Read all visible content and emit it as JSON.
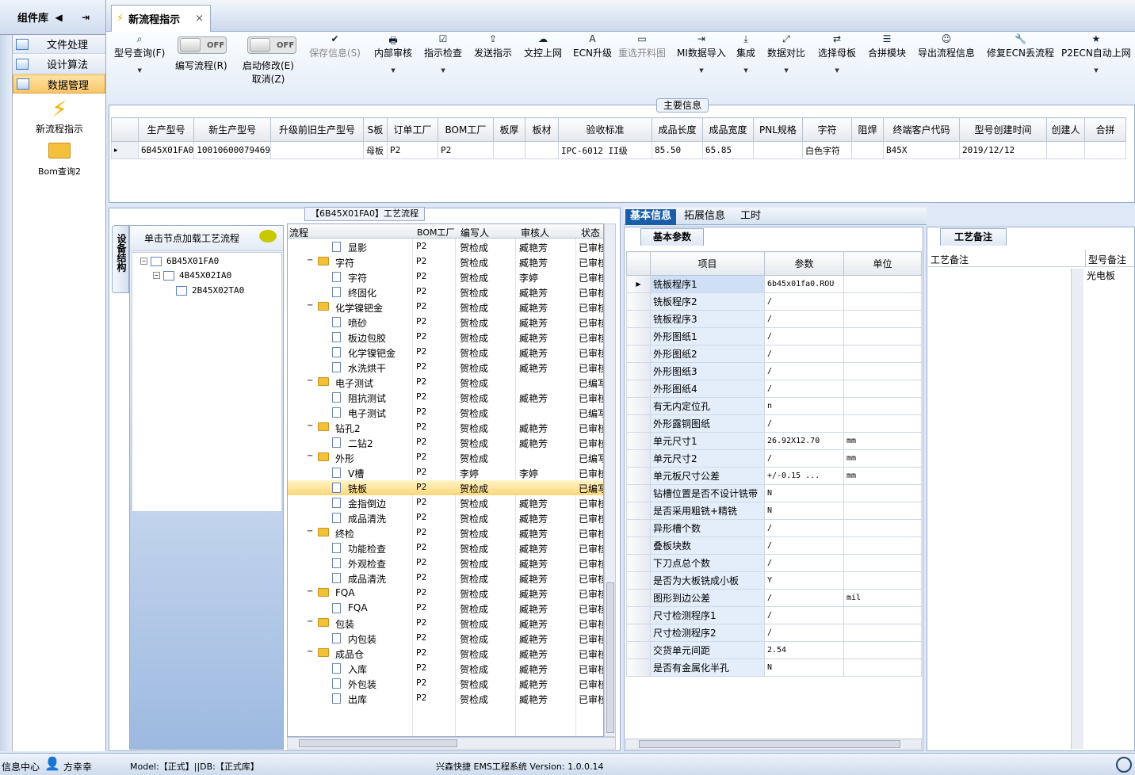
{
  "sidebar": {
    "title": "组件库",
    "items": [
      {
        "label": "文件处理"
      },
      {
        "label": "设计算法"
      },
      {
        "label": "数据管理"
      }
    ],
    "launchers": [
      {
        "label": "新流程指示"
      },
      {
        "label": "Bom查询2"
      }
    ]
  },
  "tab": {
    "title": "新流程指示",
    "close": "×"
  },
  "toolbar": {
    "buttons": [
      {
        "label": "型号查询(F)",
        "icon": "search-icon",
        "glyph": "🔍"
      },
      {
        "label": "编写流程(R)"
      },
      {
        "label": "启动修改(E)",
        "sub": "取消(Z)"
      },
      {
        "label": "保存信息(S)",
        "glyph": "✔"
      },
      {
        "label": "内部审核",
        "glyph": "🖶"
      },
      {
        "label": "指示检查",
        "glyph": "☑"
      },
      {
        "label": "发送指示",
        "glyph": "⇪"
      },
      {
        "label": "文控上网",
        "glyph": "☁"
      },
      {
        "label": "ECN升级",
        "glyph": "A"
      },
      {
        "label": "重选开料图",
        "glyph": "▭"
      },
      {
        "label": "MI数据导入",
        "glyph": "⇥"
      },
      {
        "label": "集成",
        "glyph": "⤓"
      },
      {
        "label": "数据对比",
        "glyph": "⤢"
      },
      {
        "label": "选择母板",
        "glyph": "⇄"
      },
      {
        "label": "合拼模块",
        "glyph": "☰"
      },
      {
        "label": "导出流程信息",
        "glyph": "☺"
      },
      {
        "label": "修复ECN丢流程",
        "glyph": "🔧"
      },
      {
        "label": "P2ECN自动上网",
        "glyph": "★"
      }
    ],
    "toggle_off": "OFF"
  },
  "main": {
    "label": "主要信息",
    "headers": [
      "生产型号",
      "新生产型号",
      "升级前旧生产型号",
      "S板",
      "订单工厂",
      "BOM工厂",
      "板厚",
      "板材",
      "验收标准",
      "成品长度",
      "成品宽度",
      "PNL规格",
      "字符",
      "阻焊",
      "终端客户代码",
      "型号创建时间",
      "创建人",
      "合拼"
    ],
    "row": [
      "6B45X01FA0",
      "10010600079469",
      "",
      "母板",
      "P2",
      "P2",
      "",
      "",
      "IPC-6012 II级",
      "85.50",
      "65.85",
      "",
      "白色字符",
      "",
      "B45X",
      "2019/12/12",
      ""
    ]
  },
  "flow": {
    "label": "【6B45X01FA0】工艺流程",
    "vtab": "设备结构",
    "tree_hint": "单击节点加载工艺流程",
    "tree": [
      "6B45X01FA0",
      "4B45X02IA0",
      "2B45X02TA0"
    ],
    "headers": [
      "流程",
      "BOM工厂",
      "编写人",
      "审核人",
      "状态"
    ],
    "rows": [
      {
        "t": "doc",
        "n": "显影",
        "f": "P2",
        "w": "贺检成",
        "r": "臧艳芳",
        "s": "已审核"
      },
      {
        "t": "fold",
        "n": "字符",
        "f": "P2",
        "w": "贺检成",
        "r": "臧艳芳",
        "s": "已审核"
      },
      {
        "t": "doc",
        "n": "字符",
        "f": "P2",
        "w": "贺检成",
        "r": "李婷",
        "s": "已审核"
      },
      {
        "t": "doc",
        "n": "终固化",
        "f": "P2",
        "w": "贺检成",
        "r": "臧艳芳",
        "s": "已审核"
      },
      {
        "t": "fold",
        "n": "化学镍钯金",
        "f": "P2",
        "w": "贺检成",
        "r": "臧艳芳",
        "s": "已审核"
      },
      {
        "t": "doc",
        "n": "喷砂",
        "f": "P2",
        "w": "贺检成",
        "r": "臧艳芳",
        "s": "已审核"
      },
      {
        "t": "doc",
        "n": "板边包胶",
        "f": "P2",
        "w": "贺检成",
        "r": "臧艳芳",
        "s": "已审核"
      },
      {
        "t": "doc",
        "n": "化学镍钯金",
        "f": "P2",
        "w": "贺检成",
        "r": "臧艳芳",
        "s": "已审核"
      },
      {
        "t": "doc",
        "n": "水洗烘干",
        "f": "P2",
        "w": "贺检成",
        "r": "臧艳芳",
        "s": "已审核"
      },
      {
        "t": "fold",
        "n": "电子测试",
        "f": "P2",
        "w": "贺检成",
        "r": "",
        "s": "已编写"
      },
      {
        "t": "doc",
        "n": "阻抗测试",
        "f": "P2",
        "w": "贺检成",
        "r": "臧艳芳",
        "s": "已审核"
      },
      {
        "t": "doc",
        "n": "电子测试",
        "f": "P2",
        "w": "贺检成",
        "r": "",
        "s": "已编写"
      },
      {
        "t": "fold",
        "n": "钻孔2",
        "f": "P2",
        "w": "贺检成",
        "r": "臧艳芳",
        "s": "已审核"
      },
      {
        "t": "doc",
        "n": "二钻2",
        "f": "P2",
        "w": "贺检成",
        "r": "臧艳芳",
        "s": "已审核"
      },
      {
        "t": "fold",
        "n": "外形",
        "f": "P2",
        "w": "贺检成",
        "r": "",
        "s": "已编写"
      },
      {
        "t": "doc",
        "n": "V槽",
        "f": "P2",
        "w": "李婷",
        "r": "李婷",
        "s": "已审核"
      },
      {
        "t": "doc",
        "n": "铣板",
        "f": "P2",
        "w": "贺检成",
        "r": "",
        "s": "已编写",
        "hl": true
      },
      {
        "t": "doc",
        "n": "金指倒边",
        "f": "P2",
        "w": "贺检成",
        "r": "臧艳芳",
        "s": "已审核"
      },
      {
        "t": "doc",
        "n": "成品清洗",
        "f": "P2",
        "w": "贺检成",
        "r": "臧艳芳",
        "s": "已审核"
      },
      {
        "t": "fold",
        "n": "终检",
        "f": "P2",
        "w": "贺检成",
        "r": "臧艳芳",
        "s": "已审核"
      },
      {
        "t": "doc",
        "n": "功能检查",
        "f": "P2",
        "w": "贺检成",
        "r": "臧艳芳",
        "s": "已审核"
      },
      {
        "t": "doc",
        "n": "外观检查",
        "f": "P2",
        "w": "贺检成",
        "r": "臧艳芳",
        "s": "已审核"
      },
      {
        "t": "doc",
        "n": "成品清洗",
        "f": "P2",
        "w": "贺检成",
        "r": "臧艳芳",
        "s": "已审核"
      },
      {
        "t": "fold",
        "n": "FQA",
        "f": "P2",
        "w": "贺检成",
        "r": "臧艳芳",
        "s": "已审核"
      },
      {
        "t": "doc",
        "n": "FQA",
        "f": "P2",
        "w": "贺检成",
        "r": "臧艳芳",
        "s": "已审核"
      },
      {
        "t": "fold",
        "n": "包装",
        "f": "P2",
        "w": "贺检成",
        "r": "臧艳芳",
        "s": "已审核"
      },
      {
        "t": "doc",
        "n": "内包装",
        "f": "P2",
        "w": "贺检成",
        "r": "臧艳芳",
        "s": "已审核"
      },
      {
        "t": "fold",
        "n": "成品仓",
        "f": "P2",
        "w": "贺检成",
        "r": "臧艳芳",
        "s": "已审核"
      },
      {
        "t": "doc",
        "n": "入库",
        "f": "P2",
        "w": "贺检成",
        "r": "臧艳芳",
        "s": "已审核"
      },
      {
        "t": "doc",
        "n": "外包装",
        "f": "P2",
        "w": "贺检成",
        "r": "臧艳芳",
        "s": "已审核"
      },
      {
        "t": "doc",
        "n": "出库",
        "f": "P2",
        "w": "贺检成",
        "r": "臧艳芳",
        "s": "已审核"
      }
    ]
  },
  "right": {
    "tabs": [
      "基本信息",
      "拓展信息",
      "工时"
    ],
    "basic_label": "基本参数",
    "param_headers": [
      "项目",
      "参数",
      "单位"
    ],
    "params": [
      [
        "铣板程序1",
        "6b45x01fa0.ROU",
        ""
      ],
      [
        "铣板程序2",
        "/",
        ""
      ],
      [
        "铣板程序3",
        "/",
        ""
      ],
      [
        "外形图纸1",
        "/",
        ""
      ],
      [
        "外形图纸2",
        "/",
        ""
      ],
      [
        "外形图纸3",
        "/",
        ""
      ],
      [
        "外形图纸4",
        "/",
        ""
      ],
      [
        "有无内定位孔",
        "n",
        ""
      ],
      [
        "外形露铜图纸",
        "/",
        ""
      ],
      [
        "单元尺寸1",
        "26.92X12.70",
        "mm"
      ],
      [
        "单元尺寸2",
        "/",
        "mm"
      ],
      [
        "单元板尺寸公差",
        "+/-0.15       ...",
        "mm"
      ],
      [
        "钻槽位置是否不设计铣带",
        "N",
        ""
      ],
      [
        "是否采用粗铣+精铣",
        "N",
        ""
      ],
      [
        "异形槽个数",
        "/",
        ""
      ],
      [
        "叠板块数",
        "/",
        ""
      ],
      [
        "下刀点总个数",
        "/",
        ""
      ],
      [
        "是否为大板铣成小板",
        "Y",
        ""
      ],
      [
        "图形到边公差",
        "/",
        "mil"
      ],
      [
        "尺寸检测程序1",
        "/",
        ""
      ],
      [
        "尺寸检测程序2",
        "/",
        ""
      ],
      [
        "交货单元间距",
        "2.54",
        ""
      ],
      [
        "是否有金属化半孔",
        "N",
        ""
      ]
    ],
    "craft_label": "工艺备注",
    "craft_headers": [
      "工艺备注",
      "型号备注"
    ],
    "model_note": "光电板"
  },
  "status": {
    "info": "信息中心",
    "user": "方幸幸",
    "model": "Model:【正式】||DB:【正式库】",
    "system": "兴森快捷 EMS工程系统 Version: 1.0.0.14"
  }
}
